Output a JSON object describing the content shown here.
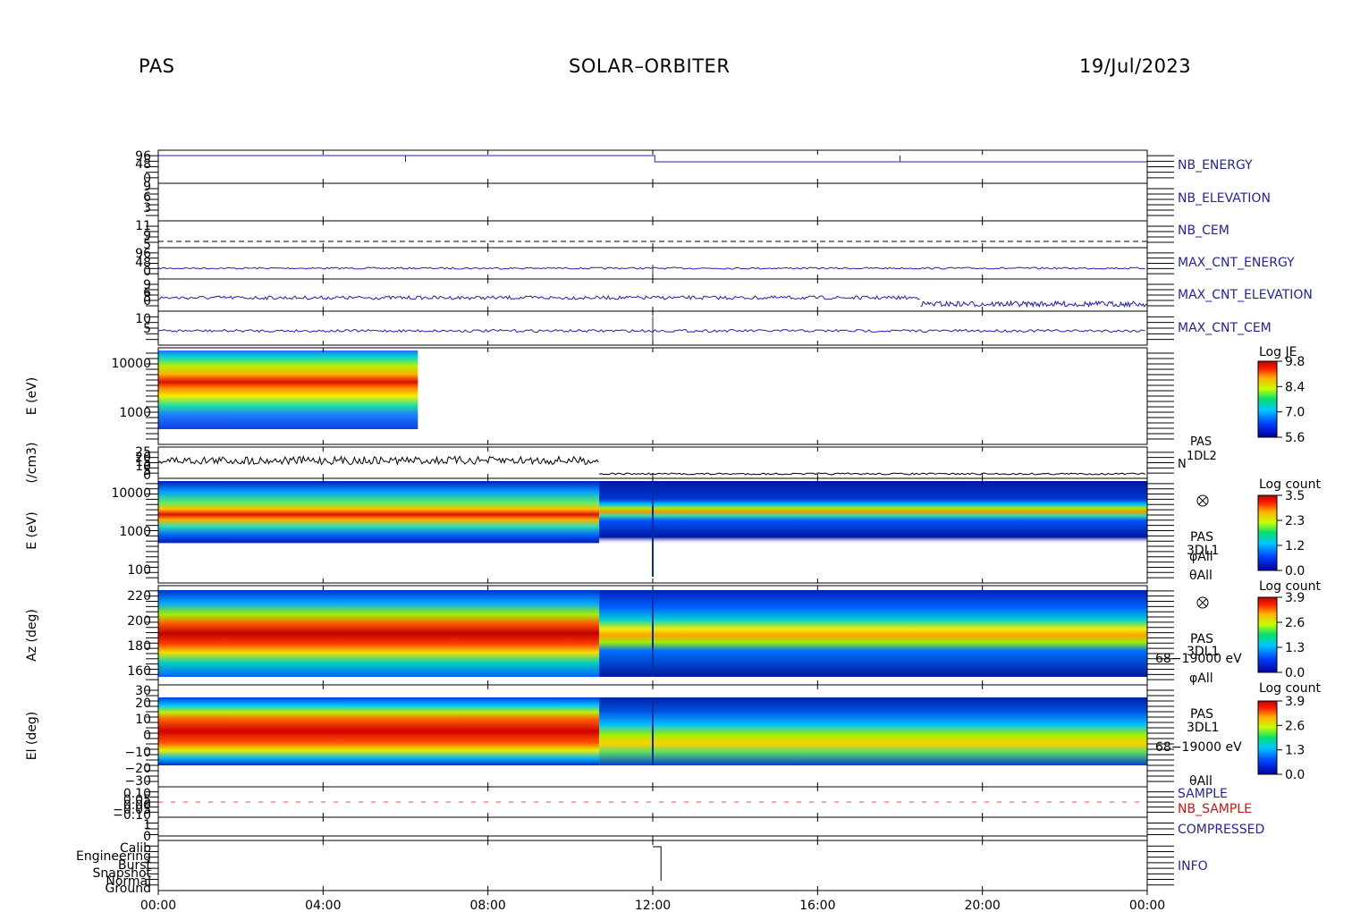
{
  "header": {
    "left": "PAS",
    "center": "SOLAR–ORBITER",
    "right": "19/Jul/2023"
  },
  "colors": {
    "line_blue": "#1f1fb8",
    "label_blue": "#2323a0",
    "label_red": "#d41010",
    "sample_red": "#e05040"
  },
  "chart_data": {
    "type": "heatmap",
    "x_ticks": [
      "00:00",
      "04:00",
      "08:00",
      "12:00",
      "16:00",
      "20:00",
      "00:00"
    ],
    "x_range_hours": [
      0,
      24
    ],
    "panels": [
      {
        "type": "line",
        "label": "NB_ENERGY",
        "y_ticks": [
          "96",
          "",
          "48",
          "",
          "",
          "0"
        ]
      },
      {
        "type": "line",
        "label": "NB_ELEVATION",
        "y_ticks": [
          "9",
          "",
          "6",
          "",
          "3",
          ""
        ]
      },
      {
        "type": "line",
        "label": "NB_CEM",
        "y_ticks": [
          "11",
          "",
          "9",
          "",
          "5",
          ""
        ]
      },
      {
        "type": "line",
        "label": "MAX_CNT_ENERGY",
        "y_ticks": [
          "96",
          "",
          "48",
          "",
          "0",
          ""
        ]
      },
      {
        "type": "line",
        "label": "MAX_CNT_ELEVATION",
        "y_ticks": [
          "9",
          "",
          "6",
          "3",
          "0",
          ""
        ]
      },
      {
        "type": "line",
        "label": "MAX_CNT_CEM",
        "y_ticks": [
          "10",
          "",
          "5",
          "",
          ""
        ]
      },
      {
        "type": "heatmap",
        "ylabel": "E (eV)",
        "y_ticks": [
          "10000",
          "1000"
        ],
        "data_end_hour": 6.3,
        "colorbar": {
          "title": "Log JE",
          "ticks": [
            "9.8",
            "8.4",
            "7.0",
            "5.6"
          ]
        }
      },
      {
        "type": "line",
        "ylabel": "(/cm3)",
        "y_ticks": [
          "25",
          "20",
          "15",
          "10",
          "5",
          "0"
        ],
        "right_labels": [
          "PAS",
          "1DL2",
          "N"
        ]
      },
      {
        "type": "heatmap",
        "ylabel": "E (eV)",
        "y_ticks": [
          "10000",
          "1000",
          "100"
        ],
        "right_labels": [
          "PAS",
          "3DL1",
          "φAll",
          "θAll"
        ],
        "colorbar": {
          "title": "Log count",
          "ticks": [
            "3.5",
            "2.3",
            "1.2",
            "0.0"
          ]
        }
      },
      {
        "type": "heatmap",
        "ylabel": "Az (deg)",
        "y_ticks": [
          "220",
          "200",
          "180",
          "160"
        ],
        "right_labels": [
          "PAS",
          "3DL1",
          "68−19000 eV",
          "φAll"
        ],
        "colorbar": {
          "title": "Log count",
          "ticks": [
            "3.9",
            "2.6",
            "1.3",
            "0.0"
          ]
        }
      },
      {
        "type": "heatmap",
        "ylabel": "El (deg)",
        "y_ticks": [
          "30",
          "20",
          "10",
          "0",
          "−10",
          "−20",
          "−30"
        ],
        "right_labels": [
          "PAS",
          "3DL1",
          "68−19000 eV",
          "θAll"
        ],
        "colorbar": {
          "title": "Log count",
          "ticks": [
            "3.9",
            "2.6",
            "1.3",
            "0.0"
          ]
        }
      },
      {
        "type": "line",
        "labels": [
          "SAMPLE",
          "NB_SAMPLE"
        ],
        "y_ticks": [
          "0.10",
          "0.05",
          "0.00",
          "−0.05",
          "−0.10"
        ]
      },
      {
        "type": "line",
        "label": "COMPRESSED",
        "y_ticks": [
          "1",
          "0"
        ]
      },
      {
        "type": "line",
        "label": "INFO",
        "y_ticks": [
          "Calib",
          "Engineering",
          "Burst",
          "Snapshot",
          "Normal",
          "Ground"
        ]
      }
    ]
  }
}
